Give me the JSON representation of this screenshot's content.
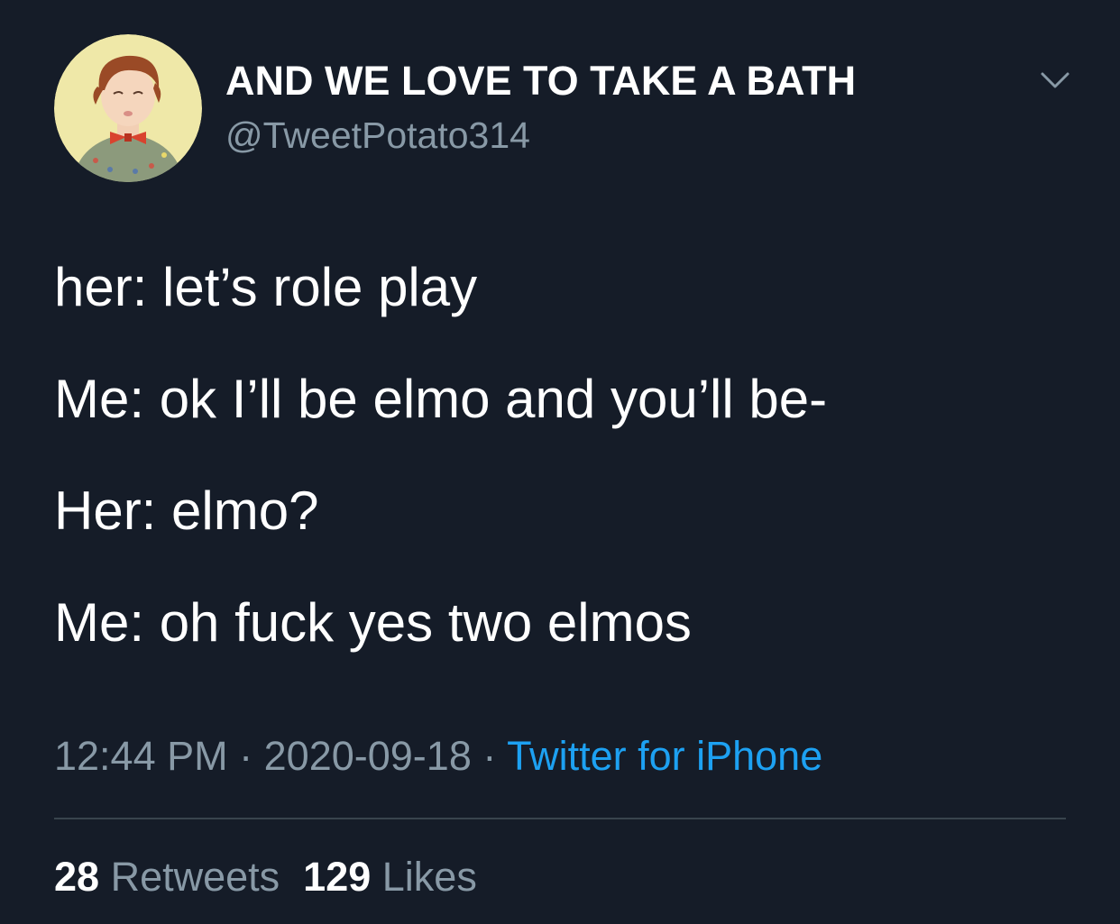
{
  "user": {
    "display_name": "AND WE LOVE TO TAKE A BATH",
    "handle": "@TweetPotato314",
    "avatar": "cartoon-boy-bowtie-avatar"
  },
  "menu_icon": "chevron-down-icon",
  "tweet": {
    "lines": [
      "her: let’s role play",
      "Me: ok I’ll be elmo and you’ll be-",
      "Her: elmo?",
      "Me: oh fuck yes two elmos"
    ]
  },
  "meta": {
    "time": "12:44 PM",
    "separator": "·",
    "date": "2020-09-18",
    "source": "Twitter for iPhone"
  },
  "stats": {
    "retweets_count": "28",
    "retweets_label": "Retweets",
    "likes_count": "129",
    "likes_label": "Likes"
  },
  "colors": {
    "background": "#151c28",
    "text": "#ffffff",
    "secondary": "#8899a6",
    "link": "#1da1f2",
    "divider": "#38444d"
  }
}
